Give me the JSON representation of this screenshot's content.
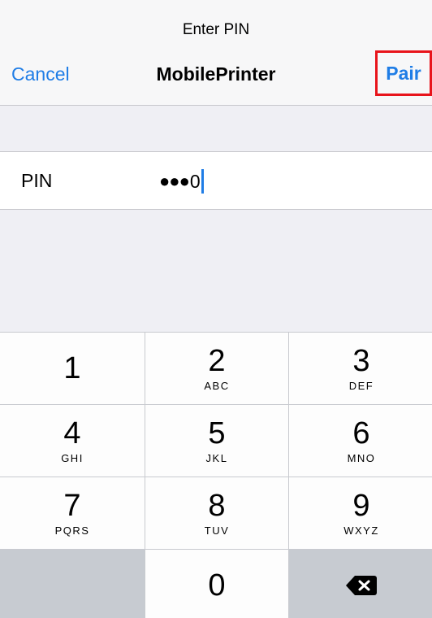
{
  "navbar": {
    "prompt": "Enter PIN",
    "cancel_label": "Cancel",
    "title": "MobilePrinter",
    "pair_label": "Pair",
    "accent_color": "#1f7de6",
    "highlight_color": "#e8141b"
  },
  "pin_row": {
    "label": "PIN",
    "masked": "●●●",
    "last_digit": "0"
  },
  "keypad": {
    "keys": [
      {
        "num": "1",
        "letters": ""
      },
      {
        "num": "2",
        "letters": "ABC"
      },
      {
        "num": "3",
        "letters": "DEF"
      },
      {
        "num": "4",
        "letters": "GHI"
      },
      {
        "num": "5",
        "letters": "JKL"
      },
      {
        "num": "6",
        "letters": "MNO"
      },
      {
        "num": "7",
        "letters": "PQRS"
      },
      {
        "num": "8",
        "letters": "TUV"
      },
      {
        "num": "9",
        "letters": "WXYZ"
      },
      {
        "num": "0",
        "letters": ""
      }
    ],
    "delete_icon": "backspace-icon"
  }
}
